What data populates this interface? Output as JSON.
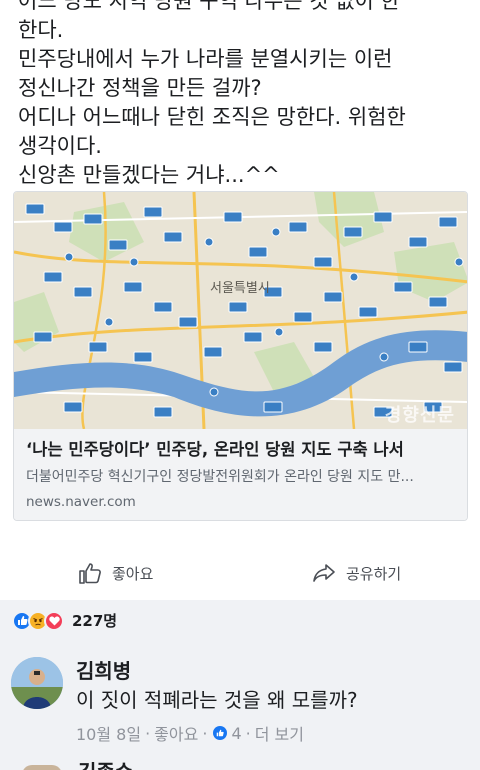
{
  "post": {
    "lines": [
      "어느 당도 지역 당원 구역 나누는 것 없이 한",
      "한다.",
      "민주당내에서 누가 나라를 분열시키는 이런",
      "정신나간 정책을 만든 걸까?",
      "어디나 어느때나 닫힌 조직은 망한다. 위험한",
      "생각이다.",
      "신앙촌 만들겠다는 거냐...^^"
    ]
  },
  "link_card": {
    "map_city_label": "서울특별시",
    "map_watermark": "경향신문",
    "title": "‘나는 민주당이다’ 민주당, 온라인 당원 지도 구축 나서",
    "description": "더불어민주당 혁신기구인 정당발전위원회가 온라인 당원 지도 만...",
    "domain": "news.naver.com"
  },
  "actions": {
    "like_label": "좋아요",
    "share_label": "공유하기"
  },
  "reactions": {
    "icons": [
      "like-icon",
      "angry-icon",
      "love-icon"
    ],
    "count": "227명"
  },
  "comment": {
    "author": "김희병",
    "text": "이 짓이 적폐라는 것을 왜 모를까?",
    "date": "10월 8일",
    "separator": "·",
    "like_label": "좋아요",
    "like_count": "4",
    "more_label": "더 보기"
  },
  "next_comment": {
    "author_peek": "김종수"
  },
  "colors": {
    "facebook_blue": "#1877f2",
    "feed_gray": "#f0f2f5",
    "meta_gray": "#90949c",
    "map_base": "#e9e4d6",
    "river": "#6f9fd4"
  }
}
